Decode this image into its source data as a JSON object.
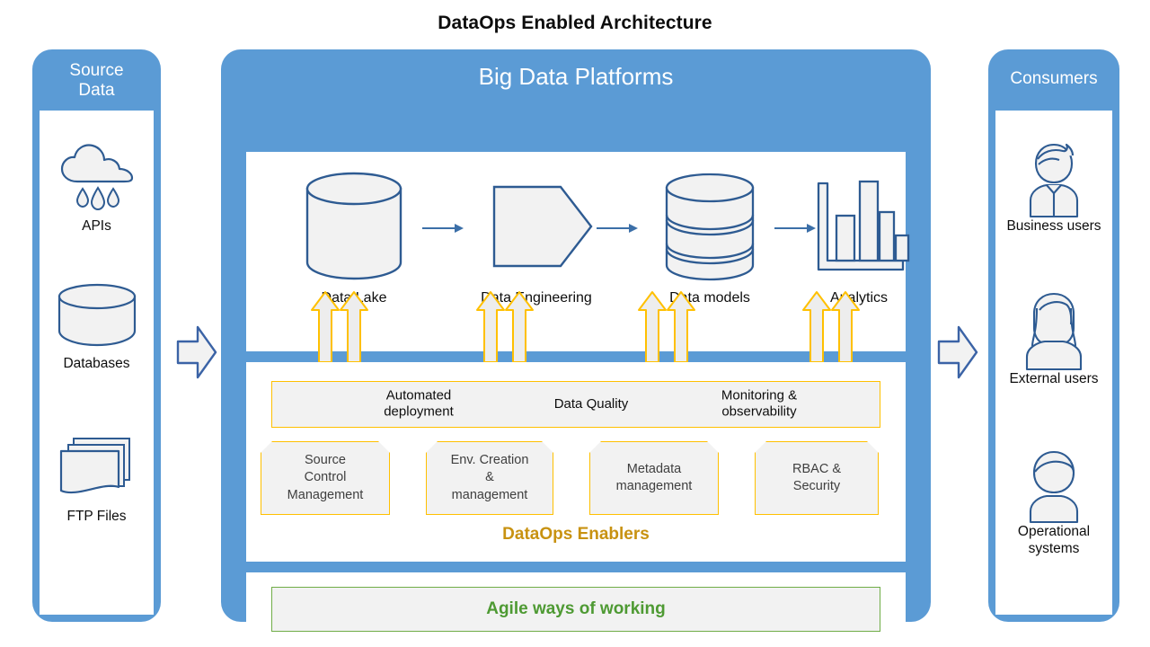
{
  "title": "DataOps Enabled Architecture",
  "colors": {
    "panel_blue": "#5B9BD5",
    "icon_outline": "#2E5B92",
    "icon_fill": "#F2F2F2",
    "enabler_border": "#FFC000",
    "enabler_title": "#C89211",
    "agile_green": "#4E9A33",
    "agile_border": "#70AD47"
  },
  "source": {
    "header": "Source\nData",
    "header_line1": "Source",
    "header_line2": "Data",
    "items": [
      {
        "label": "APIs",
        "icon": "cloud-rain-icon"
      },
      {
        "label": "Databases",
        "icon": "database-cylinder-icon"
      },
      {
        "label": "FTP Files",
        "icon": "file-stack-icon"
      }
    ]
  },
  "platform": {
    "header": "Big Data Platforms",
    "pipeline": [
      {
        "label": "Data Lake",
        "icon": "cylinder-icon"
      },
      {
        "label": "Data Engineering",
        "icon": "pentagon-arrow-icon"
      },
      {
        "label": "Data models",
        "icon": "stacked-database-icon"
      },
      {
        "label": "Analytics",
        "icon": "bar-chart-icon"
      }
    ],
    "enablers_topbar": [
      "Automated\ndeployment",
      "Data Quality",
      "Monitoring &\nobservability"
    ],
    "enablers_topbar_lines": [
      [
        "Automated",
        "deployment"
      ],
      [
        "Data Quality"
      ],
      [
        "Monitoring &",
        "observability"
      ]
    ],
    "enablers": [
      {
        "lines": [
          "Source",
          "Control",
          "Management"
        ]
      },
      {
        "lines": [
          "Env. Creation",
          "&",
          "management"
        ]
      },
      {
        "lines": [
          "Metadata",
          "management"
        ]
      },
      {
        "lines": [
          "RBAC &",
          "Security"
        ]
      }
    ],
    "enablers_title": "DataOps Enablers",
    "agile": "Agile ways of working"
  },
  "consumers": {
    "header": "Consumers",
    "items": [
      {
        "lines": [
          "Business users"
        ],
        "icon": "business-user-icon"
      },
      {
        "lines": [
          "External users"
        ],
        "icon": "external-user-icon"
      },
      {
        "lines": [
          "Operational",
          "systems"
        ],
        "icon": "operational-system-icon"
      }
    ]
  },
  "connectors": {
    "left_arrow": "right-chevron-arrow-icon",
    "right_arrow": "right-chevron-arrow-icon",
    "pipeline_arrows": [
      "arrow-right-icon",
      "arrow-right-icon",
      "arrow-right-icon"
    ],
    "support_arrows_count": 8
  }
}
